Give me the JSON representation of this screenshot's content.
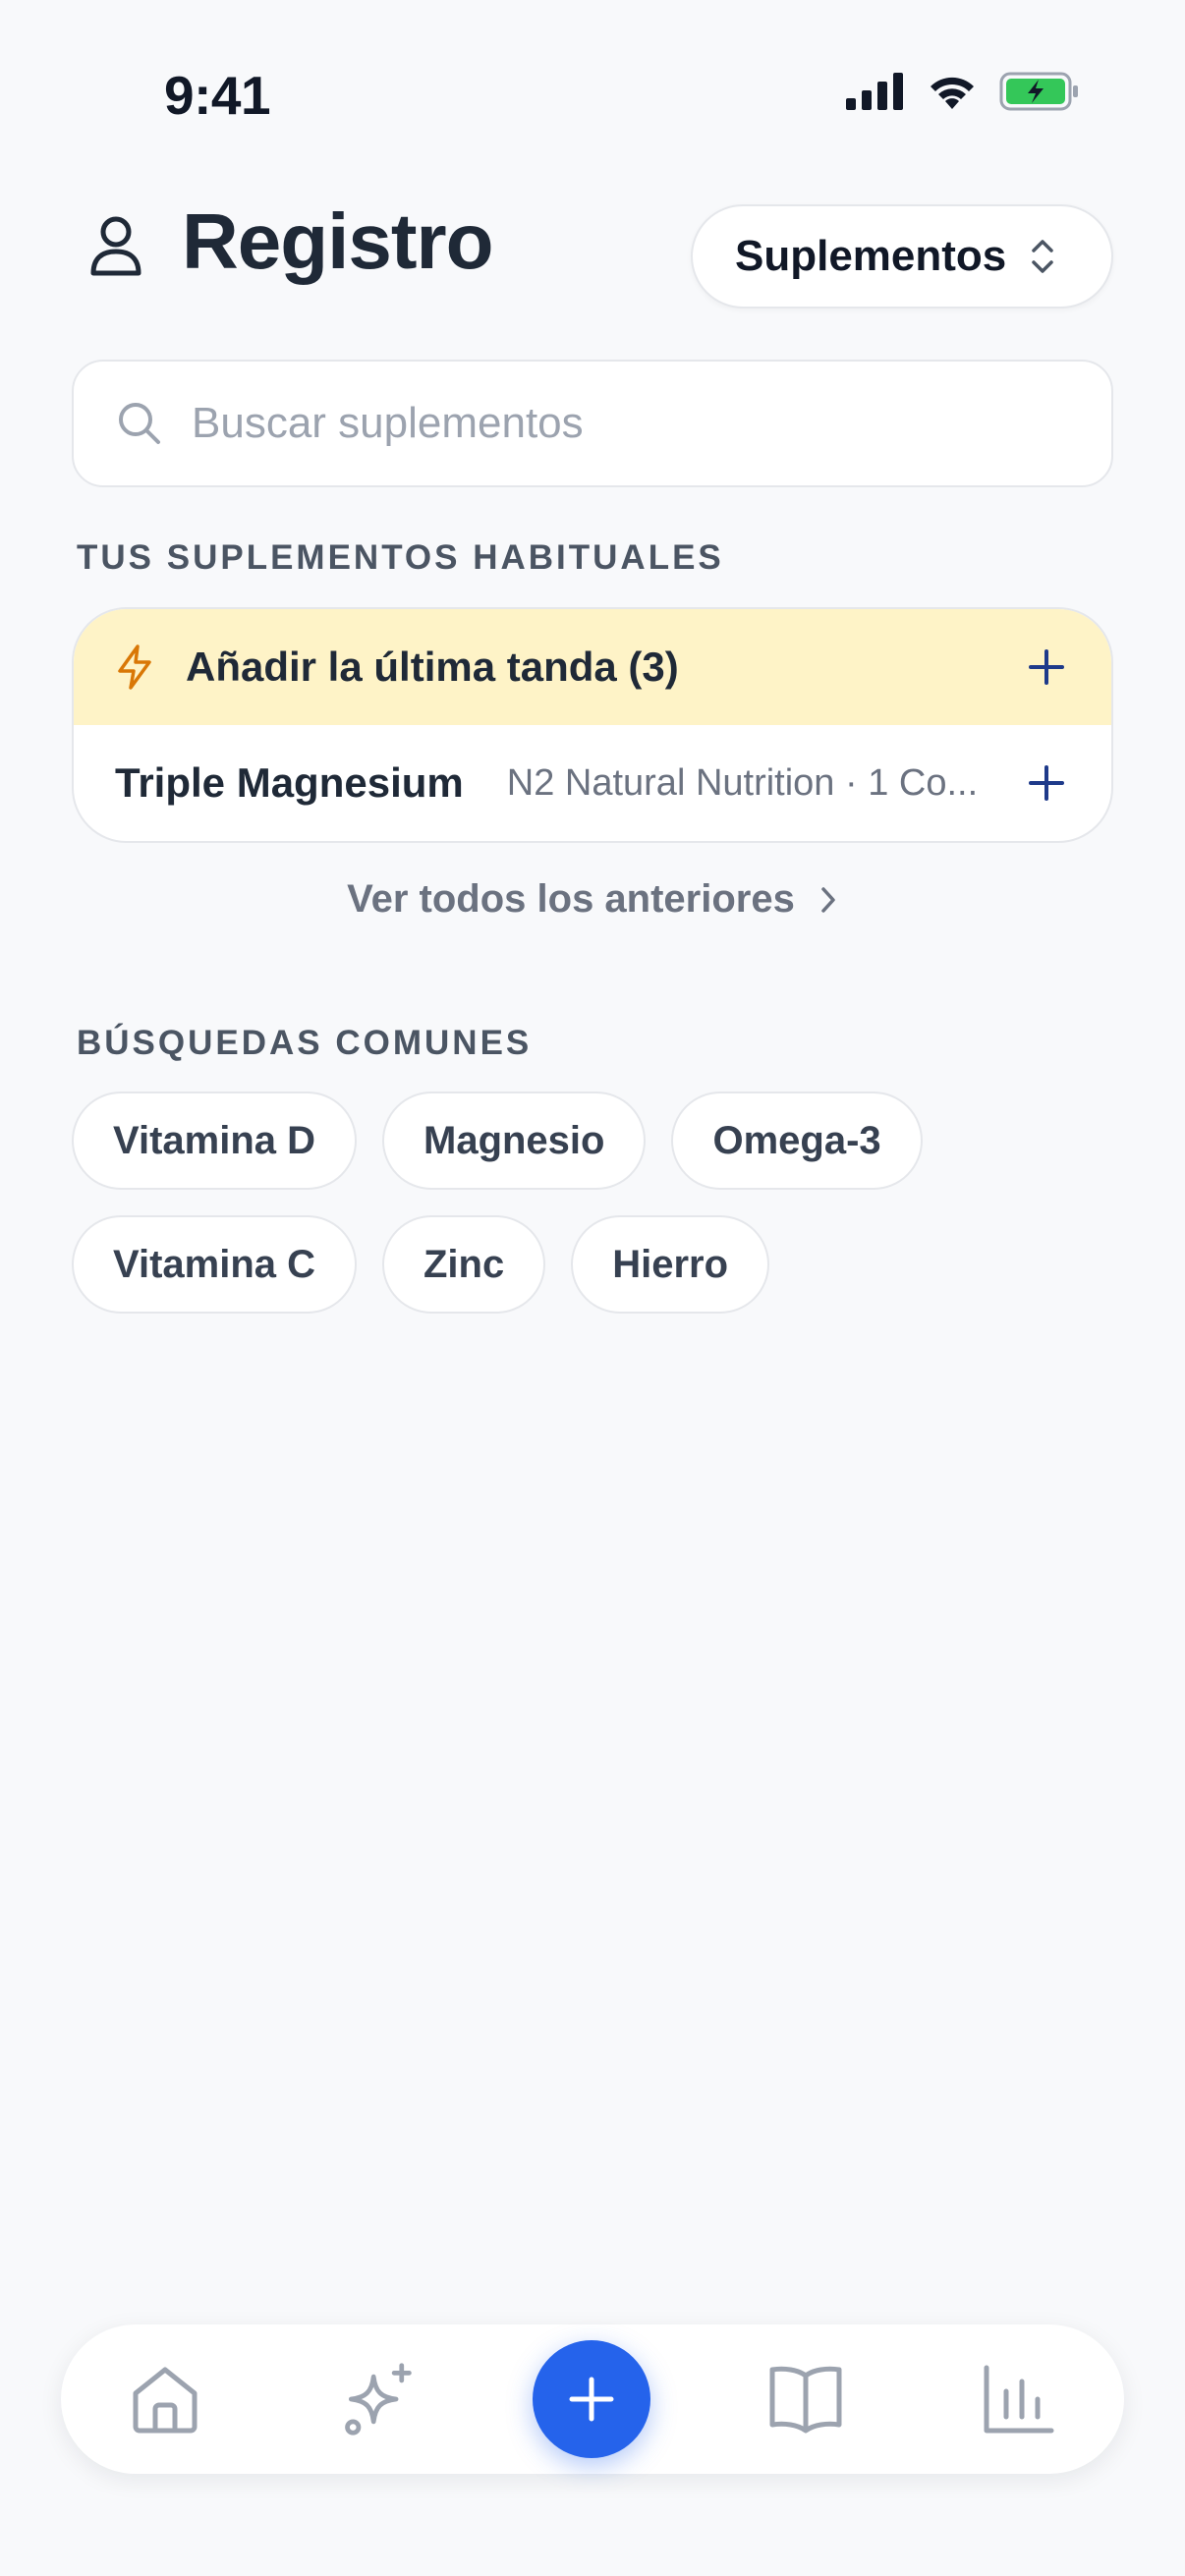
{
  "status_bar": {
    "time": "9:41"
  },
  "header": {
    "title": "Registro",
    "category_value": "Suplementos"
  },
  "search": {
    "placeholder": "Buscar suplementos"
  },
  "habitual": {
    "section_title": "TUS SUPLEMENTOS HABITUALES",
    "quick_add_label": "Añadir la última tanda (3)",
    "items": [
      {
        "name": "Triple Magnesium",
        "detail": "N2 Natural Nutrition · 1 Co..."
      }
    ],
    "see_all_label": "Ver todos los anteriores"
  },
  "common_searches": {
    "section_title": "BÚSQUEDAS COMUNES",
    "chips": [
      "Vitamina D",
      "Magnesio",
      "Omega-3",
      "Vitamina C",
      "Zinc",
      "Hierro"
    ]
  },
  "tabbar": {
    "items": [
      "home-icon",
      "sparkles-icon",
      "add-icon",
      "book-icon",
      "chart-icon"
    ],
    "accent_color": "#2563EB"
  },
  "colors": {
    "highlight_bg": "#FEF3C7",
    "bolt": "#D97706",
    "plus": "#1E3A8A"
  }
}
